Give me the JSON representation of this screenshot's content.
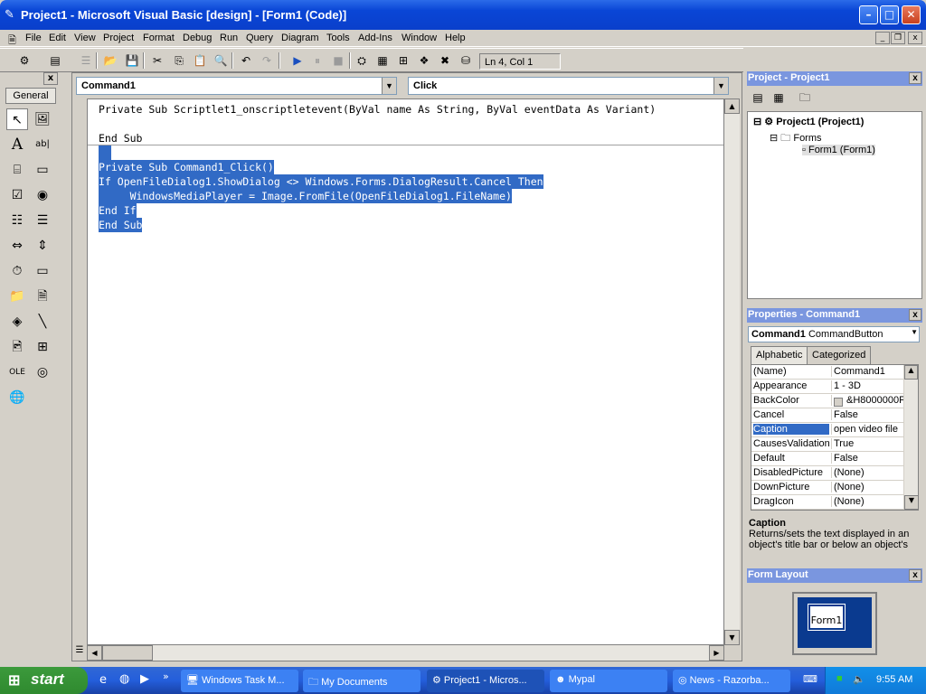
{
  "window": {
    "title": "Project1 - Microsoft Visual Basic [design] - [Form1 (Code)]",
    "min": "–",
    "max": "□",
    "close": "✕"
  },
  "menu": [
    "File",
    "Edit",
    "View",
    "Project",
    "Format",
    "Debug",
    "Run",
    "Query",
    "Diagram",
    "Tools",
    "Add-Ins",
    "Window",
    "Help"
  ],
  "mdi": {
    "min": "_",
    "restore": "❐",
    "close": "x"
  },
  "toolbar": {
    "position": "Ln 4, Col 1"
  },
  "toolbox": {
    "tab": "General",
    "close": "x"
  },
  "code": {
    "object": "Command1",
    "procedure": "Click",
    "lines": [
      "Private Sub Scriptlet1_onscriptletevent(ByVal name As String, ByVal eventData As Variant)",
      "",
      "End Sub",
      "",
      "Private Sub Command1_Click()",
      "If OpenFileDialog1.ShowDialog <> Windows.Forms.DialogResult.Cancel Then",
      "     WindowsMediaPlayer = Image.FromFile(OpenFileDialog1.FileName)",
      "End If",
      "End Sub"
    ]
  },
  "project": {
    "title": "Project - Project1",
    "close": "x",
    "root": "Project1 (Project1)",
    "folder": "Forms",
    "item": "Form1 (Form1)"
  },
  "properties": {
    "title": "Properties - Command1",
    "close": "x",
    "object_name": "Command1",
    "object_type": "CommandButton",
    "tabs": [
      "Alphabetic",
      "Categorized"
    ],
    "rows": [
      {
        "name": "(Name)",
        "value": "Command1"
      },
      {
        "name": "Appearance",
        "value": "1 - 3D"
      },
      {
        "name": "BackColor",
        "value": "&H8000000F"
      },
      {
        "name": "Cancel",
        "value": "False"
      },
      {
        "name": "Caption",
        "value": "open video file"
      },
      {
        "name": "CausesValidation",
        "value": "True"
      },
      {
        "name": "Default",
        "value": "False"
      },
      {
        "name": "DisabledPicture",
        "value": "(None)"
      },
      {
        "name": "DownPicture",
        "value": "(None)"
      },
      {
        "name": "DragIcon",
        "value": "(None)"
      }
    ],
    "desc_title": "Caption",
    "desc_text": "Returns/sets the text displayed in an object's title bar or below an object's"
  },
  "layout": {
    "title": "Form Layout",
    "close": "x",
    "form_label": "Form1"
  },
  "taskbar": {
    "start": "start",
    "quick_more": "»",
    "tasks": [
      "Windows Task M...",
      "My Documents",
      "Project1 - Micros...",
      "Mypal",
      "News - Razorba..."
    ],
    "clock": "9:55 AM"
  },
  "colors": {
    "selection": "#316ac5",
    "titlebar": "#0a46d6",
    "panel_title": "#7a96df"
  }
}
